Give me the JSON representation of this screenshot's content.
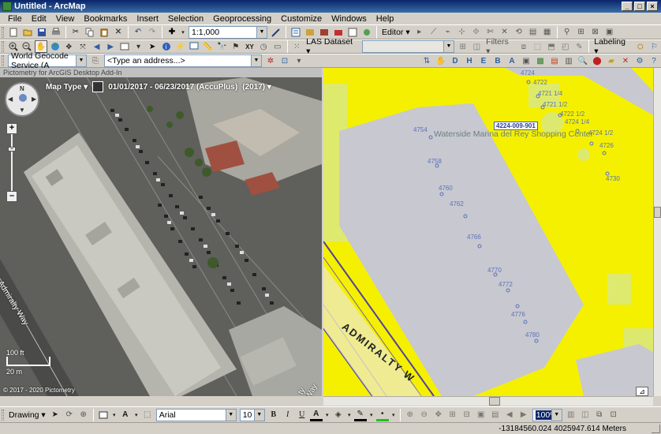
{
  "window": {
    "title": "Untitled - ArcMap",
    "minimize": "_",
    "maximize": "□",
    "close": "×"
  },
  "menu": [
    "File",
    "Edit",
    "View",
    "Bookmarks",
    "Insert",
    "Selection",
    "Geoprocessing",
    "Customize",
    "Windows",
    "Help"
  ],
  "standard_toolbar": {
    "scale_value": "1:1,000",
    "editor_label": "Editor ▾"
  },
  "tools_toolbar": {
    "las_label": "LAS Dataset ▾",
    "filters_label": "Filters ▾",
    "labeling_label": "Labeling ▾"
  },
  "geocode_toolbar": {
    "service_value": "World Geocode Service (A",
    "address_placeholder": "<Type an address...>"
  },
  "pictometry": {
    "pane_title": "Pictometry for ArcGIS Desktop Add-In",
    "map_type": "Map Type ▾",
    "date_range": "01/01/2017 - 06/23/2017 (AccuPlus)",
    "year": "(2017) ▾",
    "scale_ft": "100 ft",
    "scale_m": "20 m",
    "copyright": "© 2017 - 2020 Pictometry",
    "street_1": "Admiralty Way",
    "street_2": "ty Way",
    "compass_n": "N"
  },
  "map": {
    "parcel_id": "4224-009-901",
    "center_name": "Waterside Marina del Rey Shopping Center",
    "street_label": "ADMIRALTY W",
    "addresses": [
      "4722",
      "4724",
      "4721 1/4",
      "4721 1/2",
      "4722 1/2",
      "4724 1/4",
      "4724 1/2",
      "4726",
      "4730",
      "4754",
      "4758",
      "4760",
      "4762",
      "4766",
      "4770",
      "4772",
      "4776",
      "4780"
    ]
  },
  "draw_toolbar": {
    "drawing_label": "Drawing ▾",
    "font_name": "Arial",
    "font_size": "10",
    "bold": "B",
    "italic": "I",
    "underline": "U",
    "zoom_value": "100%"
  },
  "status": {
    "coordinates": "-13184560.024  4025947.614 Meters"
  }
}
